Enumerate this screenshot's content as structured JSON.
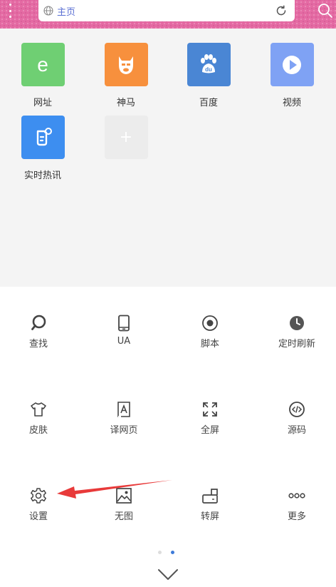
{
  "browser": {
    "url_text": "主页",
    "icons": [
      "menu-dots-icon",
      "globe-icon",
      "refresh-icon",
      "search-icon"
    ]
  },
  "shortcuts": [
    {
      "label": "网址",
      "icon": "e-letter-icon",
      "color": "#6fcf73"
    },
    {
      "label": "神马",
      "icon": "alpaca-icon",
      "color": "#f7903d"
    },
    {
      "label": "百度",
      "icon": "baidu-paw-icon",
      "color": "#4a86d4"
    },
    {
      "label": "视频",
      "icon": "play-icon",
      "color": "#7fa2f4"
    },
    {
      "label": "实时热讯",
      "icon": "news-icon",
      "color": "#3d8ef0"
    },
    {
      "label": "",
      "icon": "add-icon",
      "color": "#ececec"
    }
  ],
  "menu": {
    "rows": [
      [
        {
          "label": "查找",
          "icon": "search-icon"
        },
        {
          "label": "UA",
          "icon": "phone-icon"
        },
        {
          "label": "脚本",
          "icon": "record-icon"
        },
        {
          "label": "定时刷新",
          "icon": "clock-icon"
        }
      ],
      [
        {
          "label": "皮肤",
          "icon": "tshirt-icon"
        },
        {
          "label": "译网页",
          "icon": "translate-icon"
        },
        {
          "label": "全屏",
          "icon": "fullscreen-icon"
        },
        {
          "label": "源码",
          "icon": "code-icon"
        }
      ],
      [
        {
          "label": "设置",
          "icon": "gear-icon"
        },
        {
          "label": "无图",
          "icon": "image-icon"
        },
        {
          "label": "转屏",
          "icon": "rotate-screen-icon"
        },
        {
          "label": "更多",
          "icon": "more-icon"
        }
      ]
    ],
    "page_indicator": {
      "pages": 2,
      "active": 2
    },
    "colors": {
      "active_dot": "#3d7bd9",
      "inactive_dot": "#dddddd",
      "arrow": "#e83a3a"
    }
  }
}
